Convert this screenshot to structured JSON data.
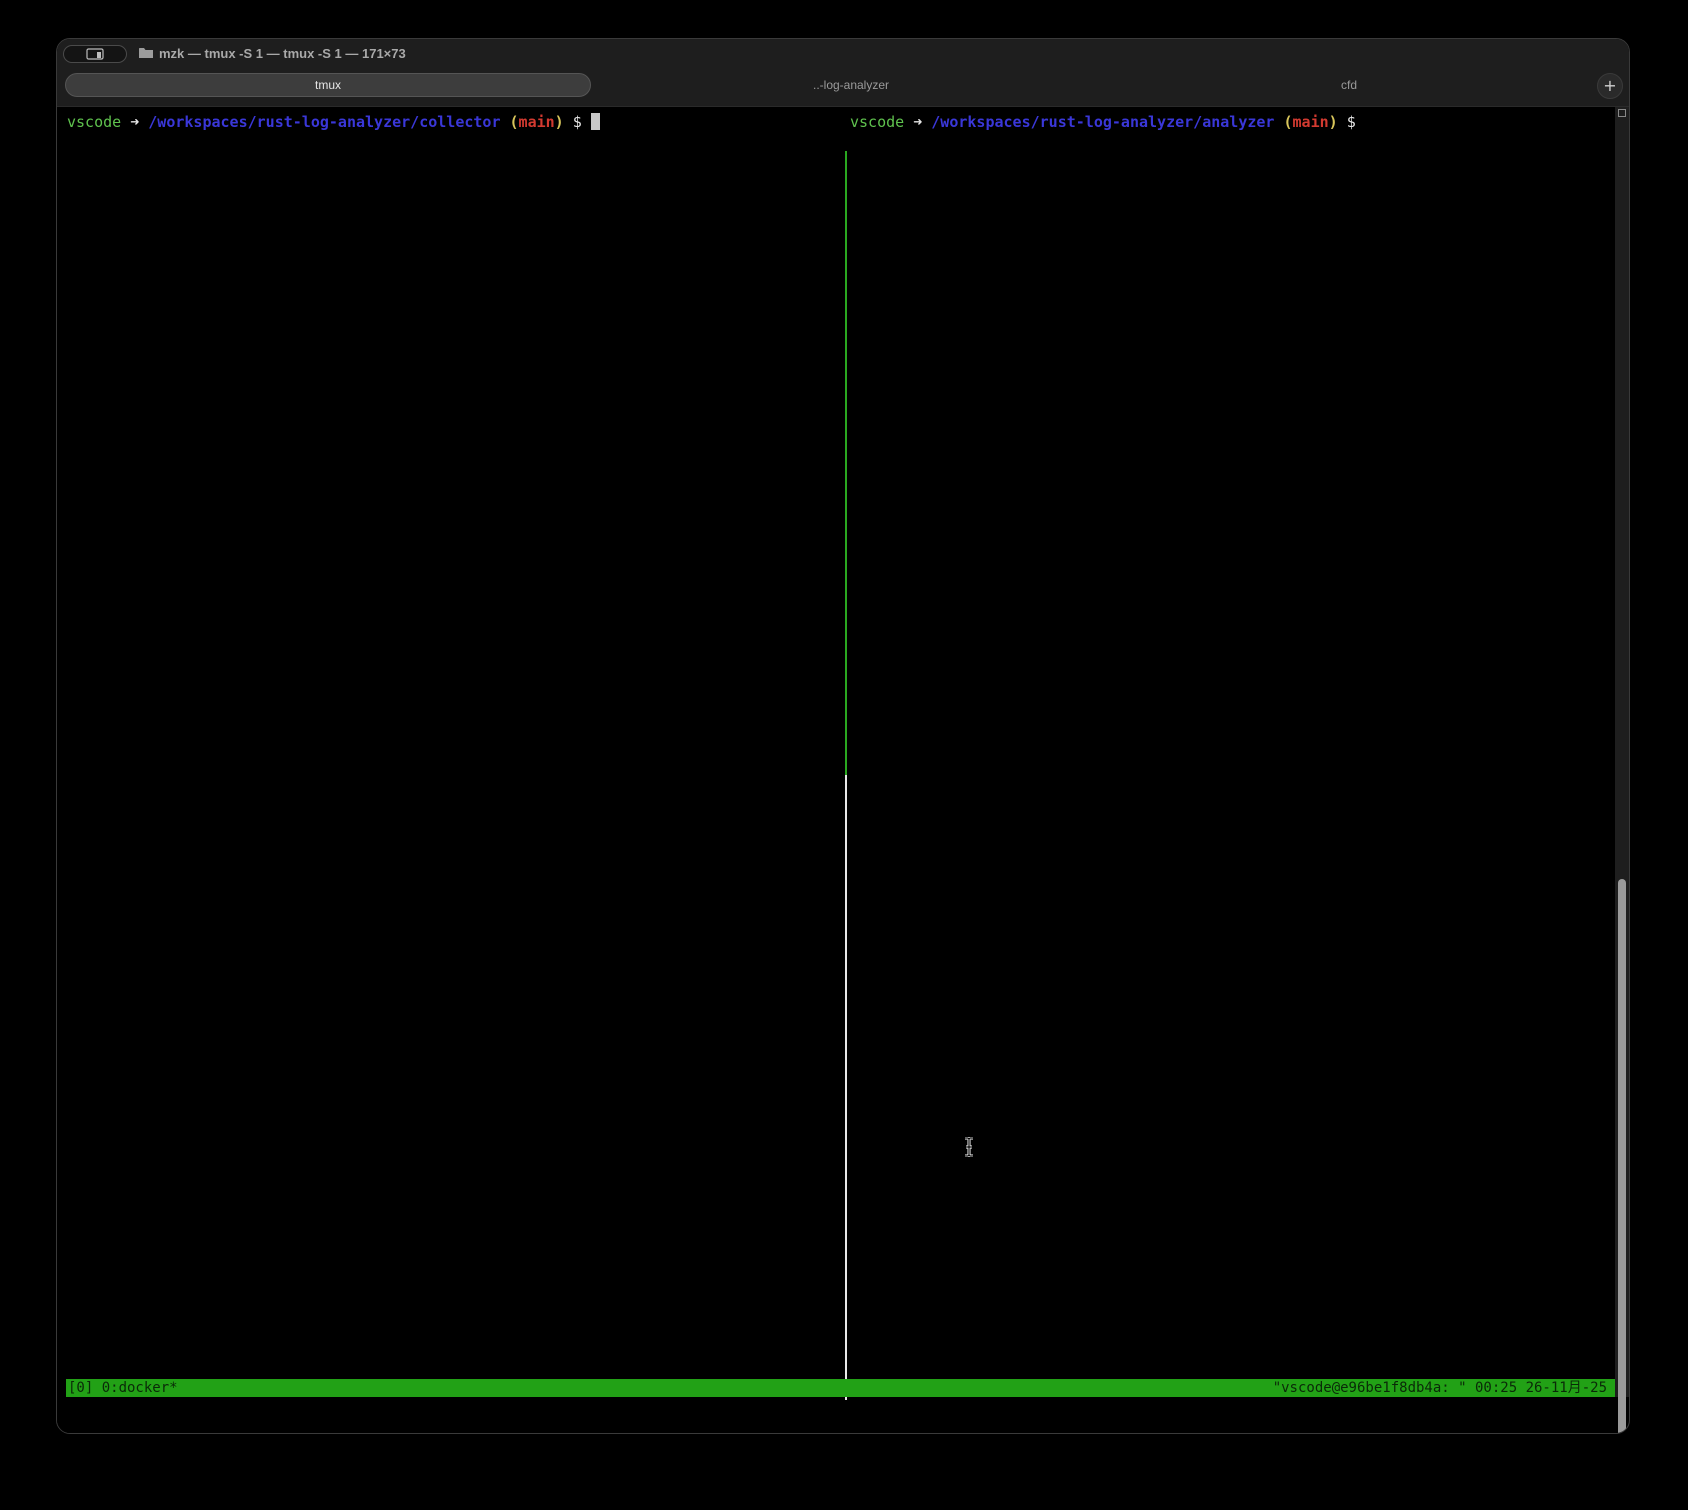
{
  "window": {
    "title": "mzk — tmux -S 1 — tmux -S 1 — 171×73"
  },
  "tabs": [
    {
      "label": "tmux",
      "active": true
    },
    {
      "label": "..-log-analyzer",
      "active": false
    },
    {
      "label": "cfd",
      "active": false
    }
  ],
  "new_tab_label": "+",
  "panes": {
    "left": {
      "user": "vscode",
      "arrow": "➜",
      "path": "/workspaces/rust-log-analyzer/collector",
      "paren_open": "(",
      "branch": "main",
      "paren_close": ")",
      "prompt": "$"
    },
    "right": {
      "user": "vscode",
      "arrow": "➜",
      "path": "/workspaces/rust-log-analyzer/analyzer",
      "paren_open": "(",
      "branch": "main",
      "paren_close": ")",
      "prompt": "$"
    }
  },
  "status_bar": {
    "left": "[0] 0:docker*",
    "right": "\"vscode@e96be1f8db4a: \" 00:25 26-11月-25"
  },
  "colors": {
    "status_bar_bg": "#22a116",
    "active_divider": "#2aa820",
    "prompt_user": "#5fc24e",
    "prompt_path": "#3a37d8",
    "prompt_branch": "#d23a30"
  },
  "icons": [
    "sidebar-toggle-icon",
    "folder-icon",
    "plus-icon",
    "ibeam-cursor-icon"
  ]
}
